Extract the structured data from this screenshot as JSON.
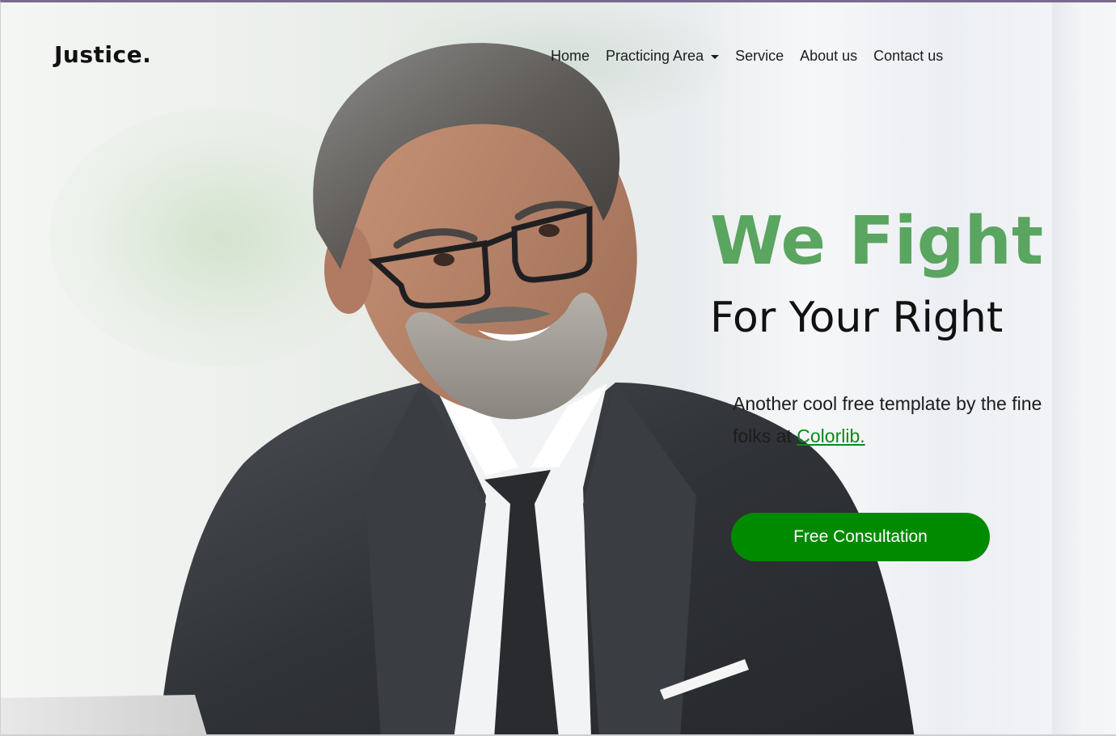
{
  "brand": {
    "name": "Justice."
  },
  "nav": {
    "items": [
      {
        "label": "Home"
      },
      {
        "label": "Practicing Area",
        "dropdown": true
      },
      {
        "label": "Service"
      },
      {
        "label": "About us"
      },
      {
        "label": "Contact us"
      }
    ]
  },
  "hero": {
    "title_line1": "We Fight",
    "title_line2": "For Your Right",
    "tagline_text": "Another cool free template by the fine folks at ",
    "tagline_link": "Colorlib.",
    "cta_label": "Free Consultation"
  },
  "colors": {
    "accent_green": "#5aa55f",
    "button_green": "#008a00",
    "link_green": "#0b8a1a",
    "text_dark": "#111111"
  },
  "icons": {
    "dropdown": "caret-down-icon"
  }
}
